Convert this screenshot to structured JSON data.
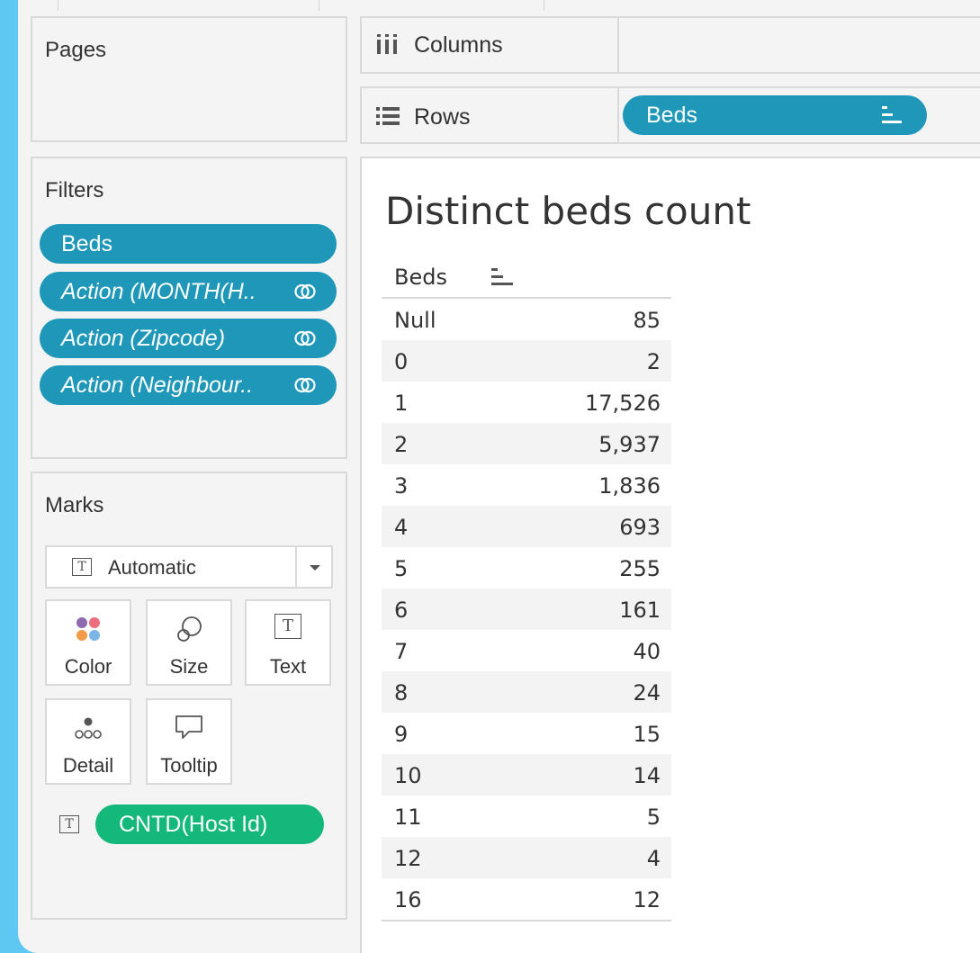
{
  "pages": {
    "title": "Pages"
  },
  "filters": {
    "title": "Filters",
    "items": [
      {
        "label": "Beds",
        "linked": false
      },
      {
        "label": "Action (MONTH(H..",
        "linked": true
      },
      {
        "label": "Action (Zipcode)",
        "linked": true
      },
      {
        "label": "Action (Neighbour..",
        "linked": true
      }
    ]
  },
  "marks": {
    "title": "Marks",
    "mark_type": "Automatic",
    "buttons": [
      "Color",
      "Size",
      "Text",
      "Detail",
      "Tooltip"
    ],
    "field": "CNTD(Host Id)"
  },
  "shelves": {
    "columns_label": "Columns",
    "rows_label": "Rows",
    "rows_field": "Beds"
  },
  "view": {
    "title": "Distinct beds count",
    "column_header": "Beds",
    "rows": [
      {
        "key": "Null",
        "value": "85"
      },
      {
        "key": "0",
        "value": "2"
      },
      {
        "key": "1",
        "value": "17,526"
      },
      {
        "key": "2",
        "value": "5,937"
      },
      {
        "key": "3",
        "value": "1,836"
      },
      {
        "key": "4",
        "value": "693"
      },
      {
        "key": "5",
        "value": "255"
      },
      {
        "key": "6",
        "value": "161"
      },
      {
        "key": "7",
        "value": "40"
      },
      {
        "key": "8",
        "value": "24"
      },
      {
        "key": "9",
        "value": "15"
      },
      {
        "key": "10",
        "value": "14"
      },
      {
        "key": "11",
        "value": "5"
      },
      {
        "key": "12",
        "value": "4"
      },
      {
        "key": "16",
        "value": "12"
      }
    ]
  },
  "colors": {
    "background": "#5ec8f2",
    "dimension_pill": "#1f97b8",
    "measure_pill": "#13b87a"
  }
}
